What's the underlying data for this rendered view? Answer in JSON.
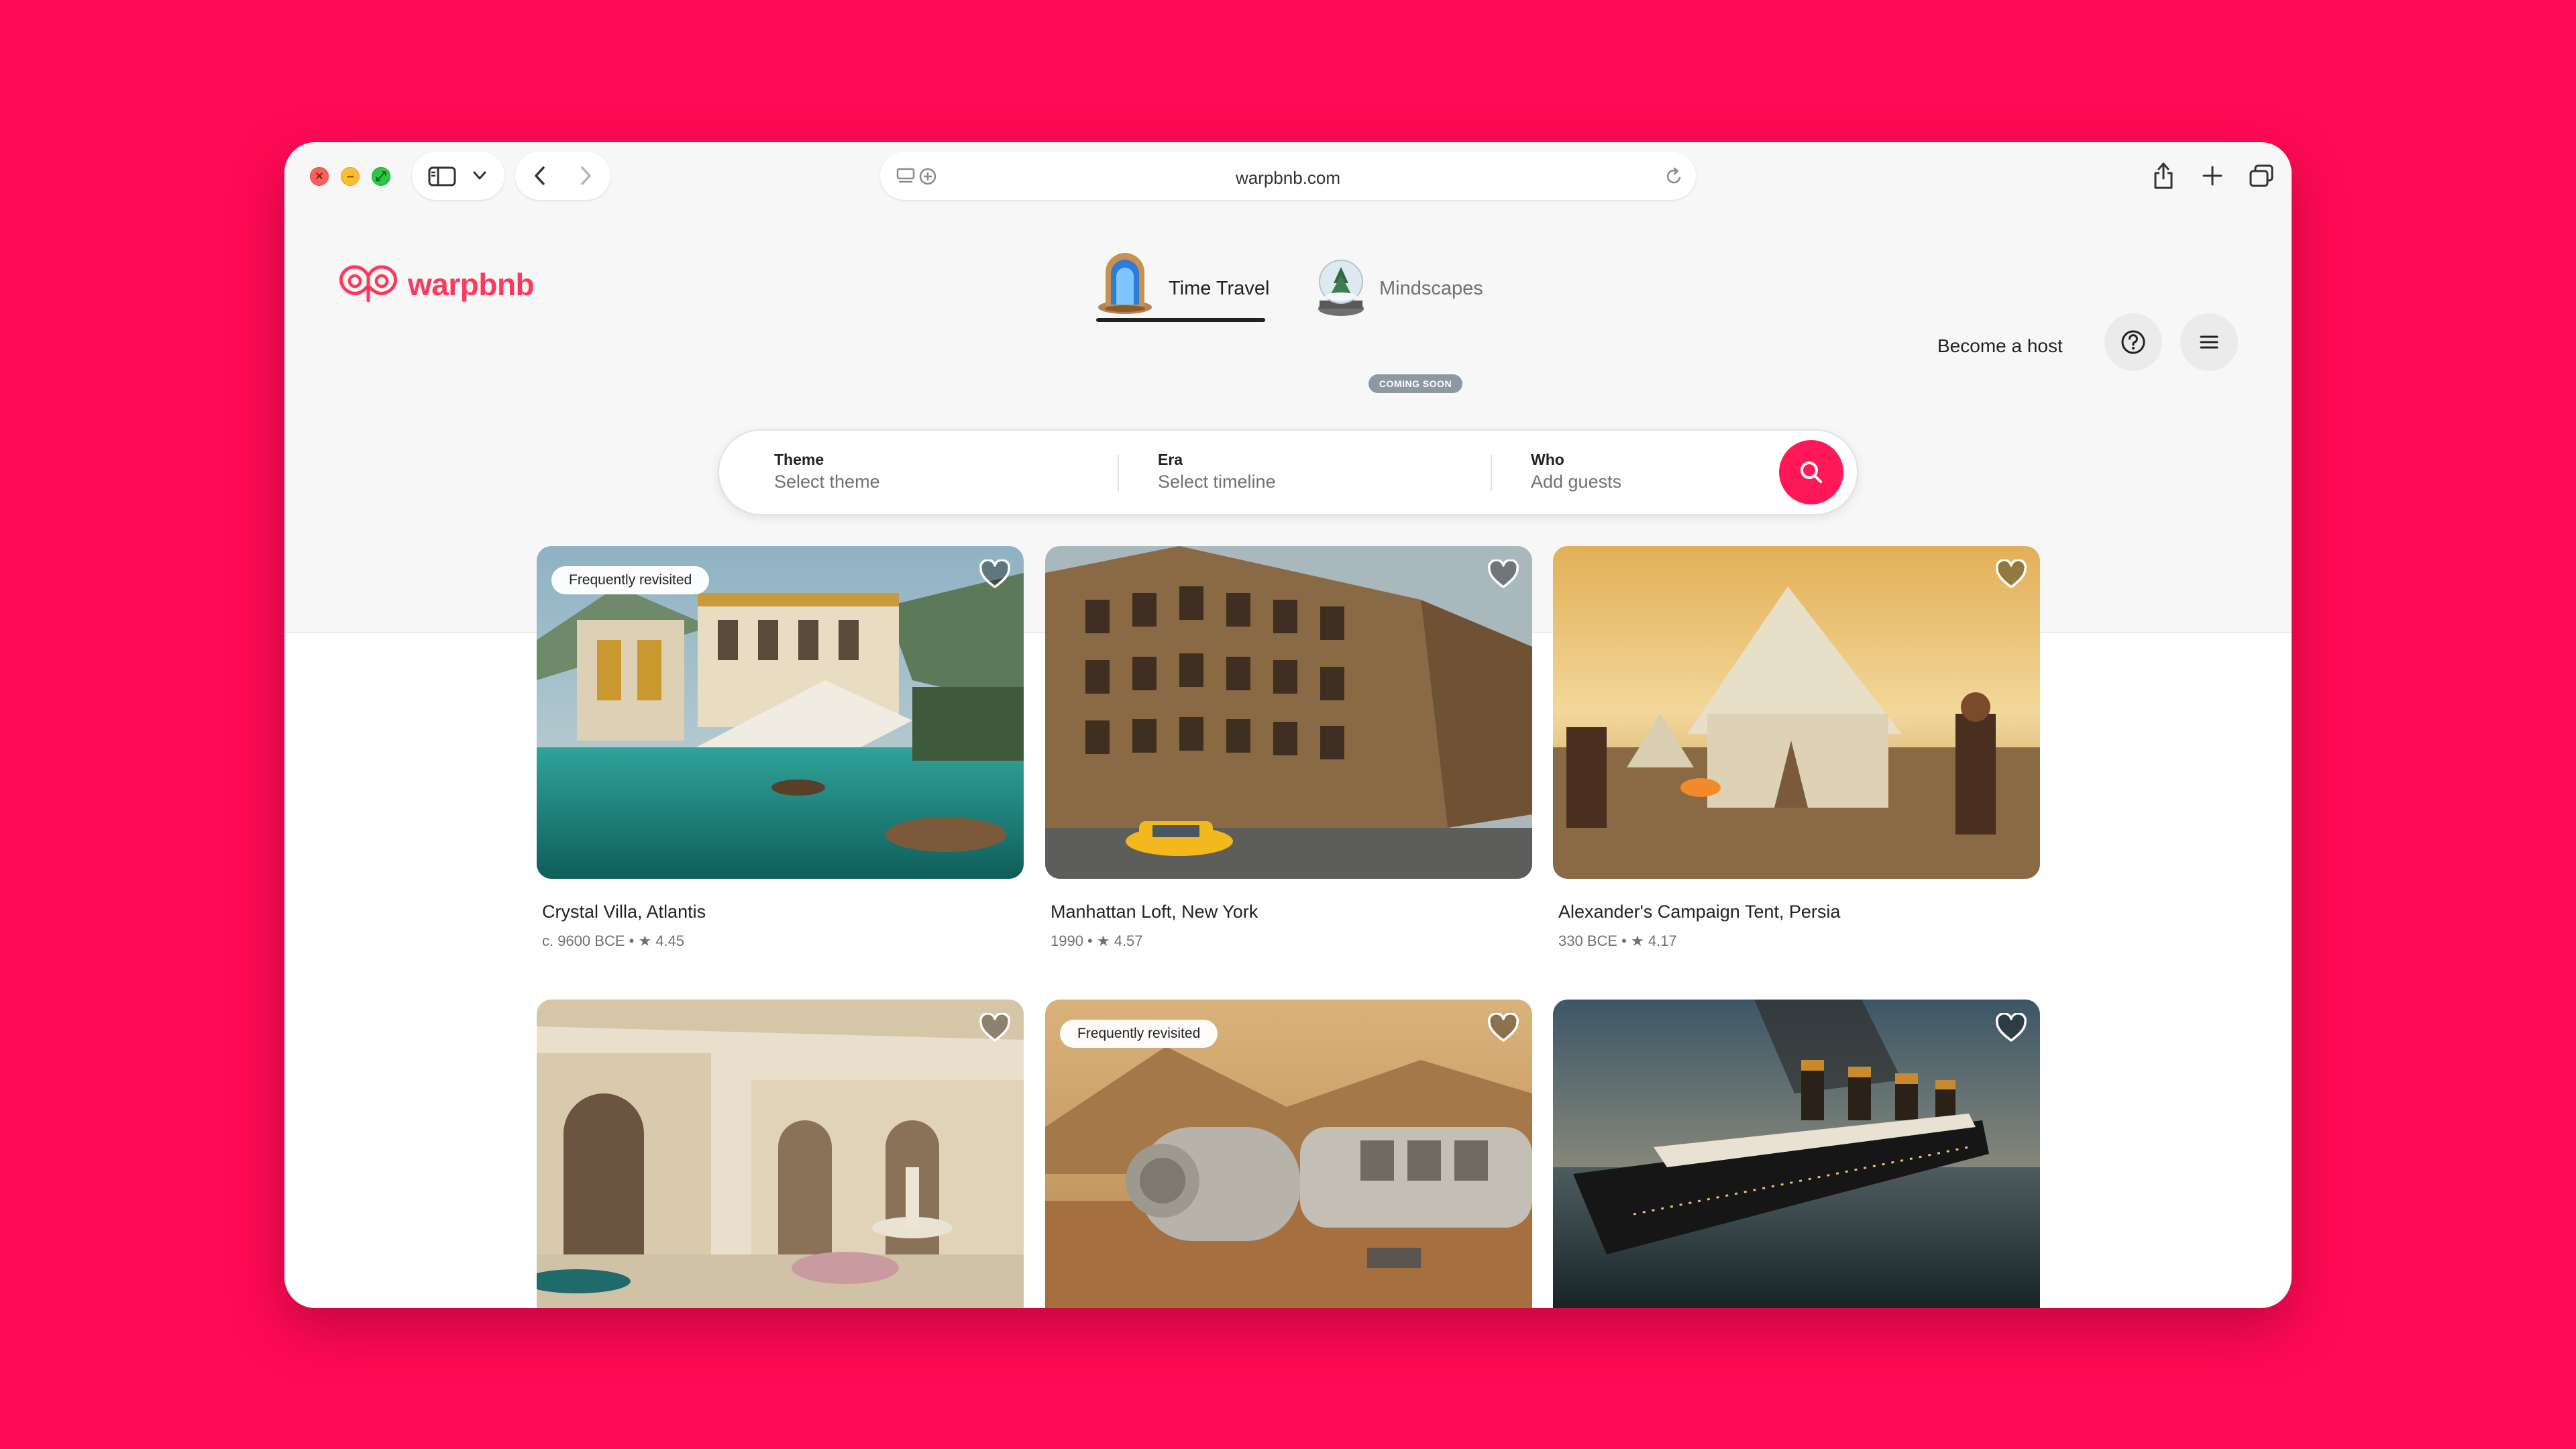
{
  "browser": {
    "url": "warpbnb.com"
  },
  "brand": {
    "name": "warpbnb",
    "accent_color": "#ff385c",
    "background_color": "#ff0a54"
  },
  "tabs": [
    {
      "label": "Time Travel",
      "icon": "portal-icon",
      "active": true
    },
    {
      "label": "Mindscapes",
      "icon": "snow-globe-icon",
      "active": false,
      "badge": "COMING SOON"
    }
  ],
  "header": {
    "host_link": "Become a host",
    "help_icon": "question-circle-icon",
    "menu_icon": "hamburger-menu-icon"
  },
  "search": {
    "theme_label": "Theme",
    "theme_placeholder": "Select theme",
    "era_label": "Era",
    "era_placeholder": "Select timeline",
    "who_label": "Who",
    "who_placeholder": "Add guests",
    "button_icon": "search-icon"
  },
  "listings": [
    {
      "title": "Crystal Villa, Atlantis",
      "meta": "c. 9600 BCE • ★ 4.45",
      "badge": "Frequently revisited"
    },
    {
      "title": "Manhattan Loft, New York",
      "meta": "1990 • ★ 4.57",
      "badge": ""
    },
    {
      "title": "Alexander's Campaign Tent, Persia",
      "meta": "330 BCE • ★ 4.17",
      "badge": ""
    },
    {
      "title": "",
      "meta": "",
      "badge": ""
    },
    {
      "title": "",
      "meta": "",
      "badge": "Frequently revisited"
    },
    {
      "title": "",
      "meta": "",
      "badge": ""
    }
  ]
}
